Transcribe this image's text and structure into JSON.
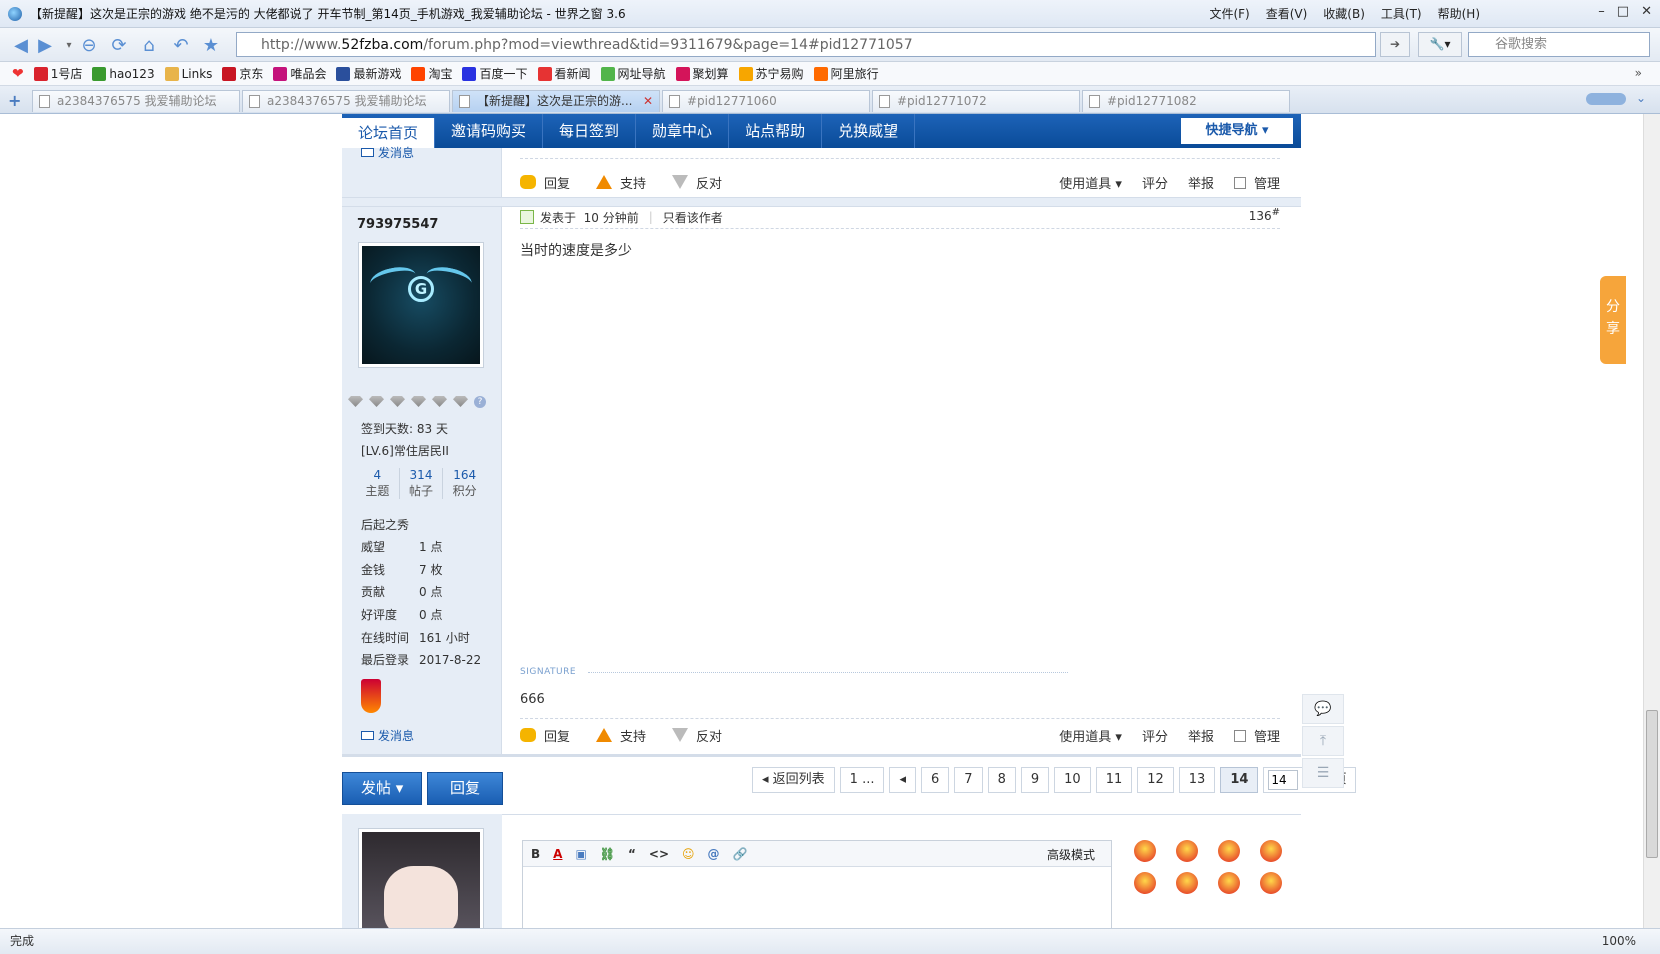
{
  "window": {
    "title": "【新提醒】这次是正宗的游戏 绝不是污的 大佬都说了 开车节制_第14页_手机游戏_我爱辅助论坛 - 世界之窗 3.6",
    "menu": [
      "文件(F)",
      "查看(V)",
      "收藏(B)",
      "工具(T)",
      "帮助(H)"
    ],
    "controls": [
      "–",
      "□",
      "✕"
    ]
  },
  "nav": {
    "url_prefix": "http://www.",
    "url_domain": "52fzba.com",
    "url_rest": "/forum.php?mod=viewthread&tid=9311679&page=14#pid12771057",
    "search_placeholder": "谷歌搜索"
  },
  "bookmarks": [
    {
      "label": "1号店",
      "color": "#d9232d"
    },
    {
      "label": "hao123",
      "color": "#3a9a2f"
    },
    {
      "label": "Links",
      "color": "#e8b44a"
    },
    {
      "label": "京东",
      "color": "#c81623"
    },
    {
      "label": "唯品会",
      "color": "#c4137c"
    },
    {
      "label": "最新游戏",
      "color": "#2a4f9c"
    },
    {
      "label": "淘宝",
      "color": "#ff4400"
    },
    {
      "label": "百度一下",
      "color": "#2932e1"
    },
    {
      "label": "看新闻",
      "color": "#e63333"
    },
    {
      "label": "网址导航",
      "color": "#52b54b"
    },
    {
      "label": "聚划算",
      "color": "#d4145a"
    },
    {
      "label": "苏宁易购",
      "color": "#f7a600"
    },
    {
      "label": "阿里旅行",
      "color": "#ff6a00"
    }
  ],
  "tabs": [
    {
      "label": "a2384376575 我爱辅助论坛"
    },
    {
      "label": "a2384376575 我爱辅助论坛"
    },
    {
      "label": "【新提醒】这次是正宗的游..."
    },
    {
      "label": "#pid12771060"
    },
    {
      "label": "#pid12771072"
    },
    {
      "label": "#pid12771082"
    }
  ],
  "forum_nav": {
    "items": [
      "论坛首页",
      "邀请码购买",
      "每日签到",
      "勋章中心",
      "站点帮助",
      "兑换威望"
    ],
    "quick_nav": "快捷导航 ▾"
  },
  "post_actions": {
    "reply": "回复",
    "support": "支持",
    "oppose": "反对",
    "use_tool": "使用道具 ▾",
    "rate": "评分",
    "report": "举报",
    "manage": "管理"
  },
  "prev_post": {
    "send_msg": "发消息"
  },
  "post": {
    "username": "793975547",
    "posted_label": "发表于",
    "posted_time": "10 分钟前",
    "only_author": "只看该作者",
    "floor": "136",
    "floor_suffix": "#",
    "content": "当时的速度是多少",
    "signature_label": "SIGNATURE",
    "signature": "666"
  },
  "profile": {
    "checkin": "签到天数: 83 天",
    "level": "[LV.6]常住居民II",
    "stats": [
      {
        "num": "4",
        "label": "主题"
      },
      {
        "num": "314",
        "label": "帖子"
      },
      {
        "num": "164",
        "label": "积分"
      }
    ],
    "group": "后起之秀",
    "fields": [
      {
        "k": "威望",
        "v": "1 点"
      },
      {
        "k": "金钱",
        "v": "7 枚"
      },
      {
        "k": "贡献",
        "v": "0 点"
      },
      {
        "k": "好评度",
        "v": "0 点"
      },
      {
        "k": "在线时间",
        "v": "161 小时"
      },
      {
        "k": "最后登录",
        "v": "2017-8-22"
      }
    ],
    "send_msg": "发消息"
  },
  "bottom": {
    "post_btn": "发帖 ▾",
    "reply_btn": "回复",
    "back_to_list": "◂ 返回列表",
    "pages": [
      "1 ...",
      "◂",
      "6",
      "7",
      "8",
      "9",
      "10",
      "11",
      "12",
      "13",
      "14"
    ],
    "current_page": "14",
    "page_input": "14",
    "total": "/ 14 页"
  },
  "editor": {
    "tools": [
      "B",
      "A",
      "▣",
      "⛓",
      "“",
      "<>",
      "☺",
      "@",
      "🔗"
    ],
    "advanced": "高级模式"
  },
  "share": "分享",
  "status": {
    "text": "完成",
    "zoom": "100%"
  }
}
